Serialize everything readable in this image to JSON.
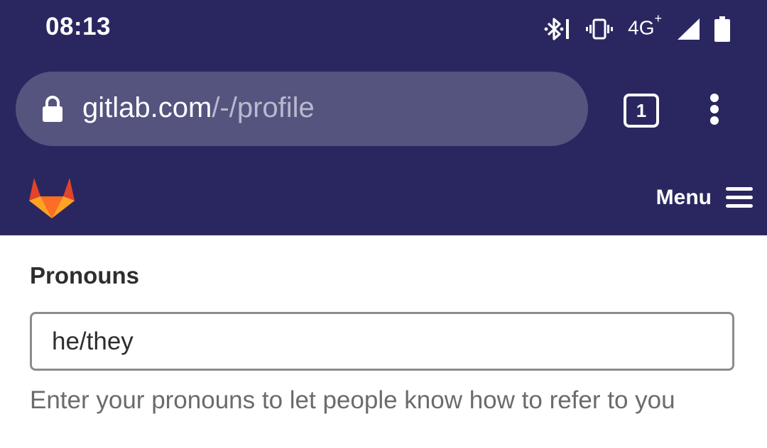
{
  "status_bar": {
    "time": "08:13",
    "network": "4G",
    "network_suffix": "+",
    "icons": [
      "bluetooth-icon",
      "vibrate-icon",
      "signal-icon",
      "battery-icon"
    ]
  },
  "browser": {
    "url_host": "gitlab.com",
    "url_path": "/-/profile",
    "tab_count": "1",
    "colors": {
      "toolbar": "#2a2760",
      "url_field": "#54547f"
    }
  },
  "header": {
    "logo": "gitlab-logo",
    "menu_label": "Menu"
  },
  "form": {
    "pronouns_label": "Pronouns",
    "pronouns_value": "he/they",
    "pronouns_help": "Enter your pronouns to let people know how to refer to you"
  }
}
